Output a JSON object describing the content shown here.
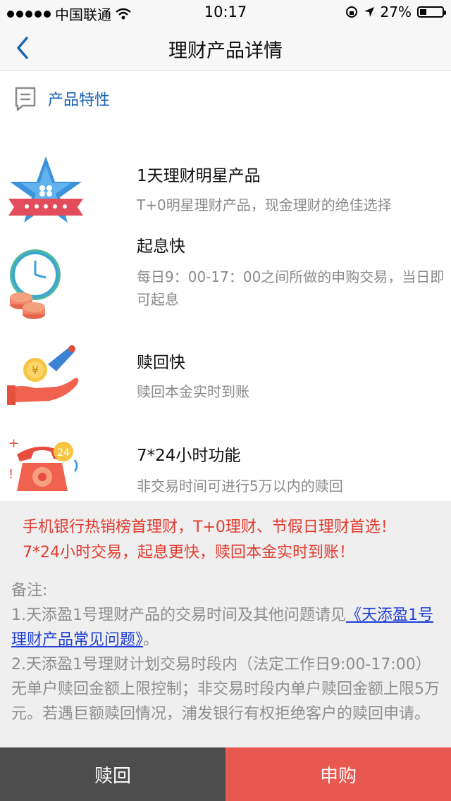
{
  "status_bar": {
    "carrier": "中国联通",
    "time": "10:17",
    "battery": "27%"
  },
  "nav": {
    "title": "理财产品详情"
  },
  "section": {
    "title": "产品特性"
  },
  "features": [
    {
      "title": "1天理财明星产品",
      "desc": "T+0明星理财产品，现金理财的绝佳选择",
      "icon": "star-icon"
    },
    {
      "title": "起息快",
      "desc": "每日9：00-17：00之间所做的申购交易，当日即可起息",
      "icon": "clock-coins-icon"
    },
    {
      "title": "赎回快",
      "desc": "赎回本金实时到账",
      "icon": "hand-coin-rocket-icon"
    },
    {
      "title": "7*24小时功能",
      "desc": "非交易时间可进行5万以内的赎回",
      "icon": "phone-24h-icon"
    }
  ],
  "promo": {
    "text": "手机银行热销榜首理财，T+0理财、节假日理财首选！7*24小时交易，起息更快，赎回本金实时到账！"
  },
  "notes": {
    "label": "备注:",
    "item1_prefix": "1.天添盈1号理财产品的交易时间及其他问题请见",
    "item1_link": "《天添盈1号理财产品常见问题》",
    "item1_suffix": "。",
    "item2": "2.天添盈1号理财计划交易时段内（法定工作日9:00-17:00）无单户赎回金额上限控制；非交易时段内单户赎回金额上限5万元。若遇巨额赎回情况，浦发银行有权拒绝客户的赎回申请。"
  },
  "buttons": {
    "redeem": "赎回",
    "buy": "申购"
  },
  "colors": {
    "accent_blue": "#1b64b4",
    "promo_red": "#e23b2f",
    "buy_button": "#e85750",
    "redeem_button": "#4d4d4d"
  }
}
